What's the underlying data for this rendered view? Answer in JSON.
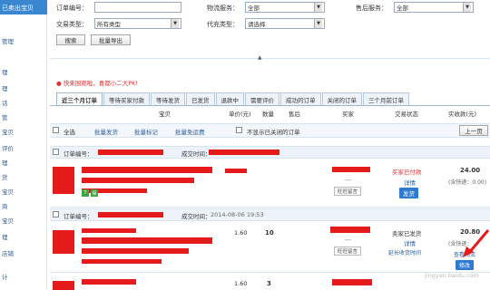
{
  "sidebar": {
    "top_label": "已卖出宝贝",
    "items": [
      "管理",
      "理",
      "理",
      "话",
      "管",
      "宝贝",
      "评价",
      "理",
      "货",
      "宝贝",
      "商",
      "宝贝",
      "理",
      "店铺",
      "计"
    ]
  },
  "filters": {
    "order_no_label": "订单编号：",
    "order_no_value": "",
    "logistics_label": "物流服务：",
    "logistics_value": "全部",
    "aftersale_label": "售后服务：",
    "aftersale_value": "全部",
    "trade_type_label": "交易类型：",
    "trade_type_value": "所有类型",
    "cod_label": "代充类型：",
    "cod_value": "请选择",
    "search_btn": "搜索",
    "export_btn": "批量导出"
  },
  "notice": "● 快来围观啦，喜都小二大PK!",
  "tabs": [
    "近三个月订单",
    "等待买家付款",
    "等待发货",
    "已发货",
    "退款中",
    "需要评价",
    "成功的订单",
    "关闭的订单",
    "三个月前订单"
  ],
  "columns": {
    "item": "宝贝",
    "unit_price": "单价(元)",
    "quantity": "数量",
    "aftersale": "售后",
    "buyer": "买家",
    "status": "交易状态",
    "amount": "实收款(元)"
  },
  "toolbar": {
    "select_all": "全选",
    "batch_ship": "批量发货",
    "batch_mark": "批量标记",
    "batch_free": "批量免运费",
    "hide_closed": "不显示已关闭的订单",
    "prev_page": "上一页"
  },
  "orders": [
    {
      "order_no_label": "订单编号：",
      "time_label": "成交时间：",
      "time_value": "",
      "unit_price": "",
      "quantity": "",
      "status": "买家已付款",
      "detail_link": "详情",
      "ship_btn": "发货",
      "amount": "24.00",
      "shipping_note": "(含快递：0.00)",
      "ww_label": "旺旺留言"
    },
    {
      "order_no_label": "订单编号：",
      "time_label": "成交时间：",
      "time_value": "2014-08-06 19:53",
      "unit_price": "1.60",
      "quantity": "10",
      "status": "卖家已发货",
      "detail_link": "详情",
      "extra_link": "延长收货时间",
      "amount": "20.80",
      "shipping_note": "(含快递：",
      "view_logistics": "查看物流",
      "modify_btn": "修改",
      "ww_label": "旺旺留言"
    },
    {
      "unit_price": "1.60",
      "quantity": "3"
    }
  ],
  "watermark": "jingyan.baidu.com"
}
